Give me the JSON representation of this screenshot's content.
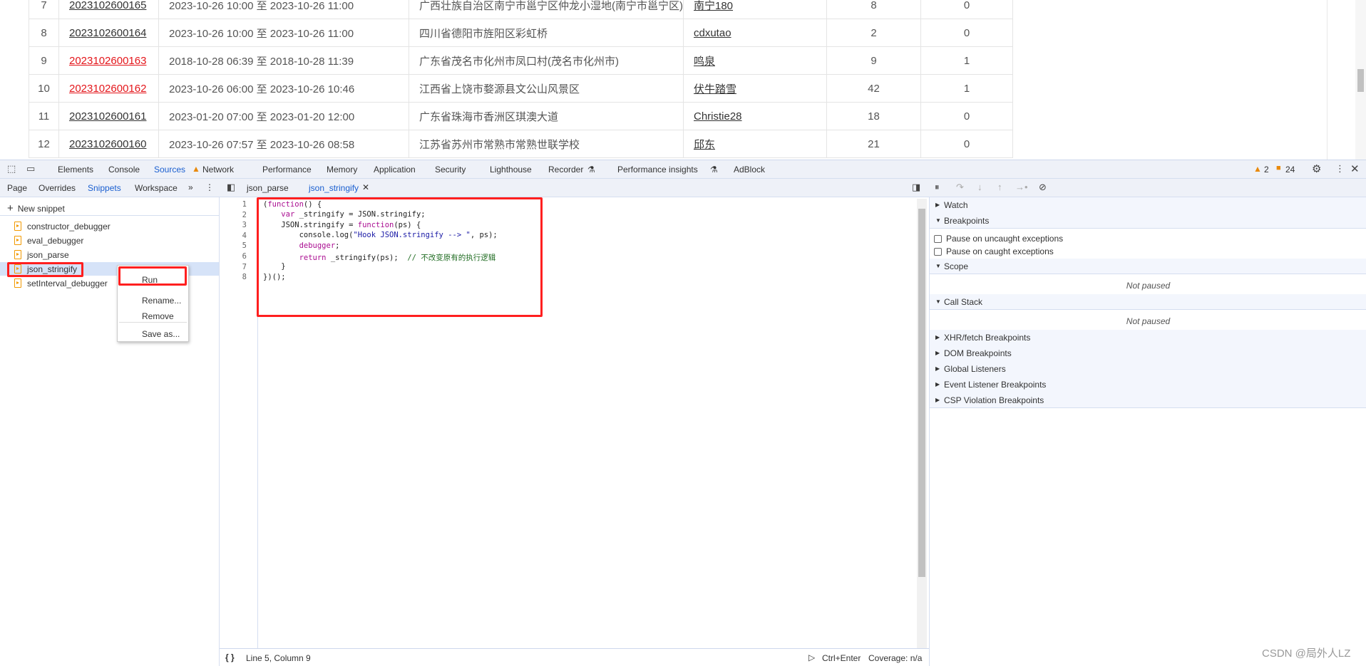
{
  "table": {
    "rows": [
      {
        "index": "7",
        "id": "2023102600165",
        "id_red": false,
        "time": "2023-10-26 10:00 至 2023-10-26 11:00",
        "address": "广西壮族自治区南宁市邕宁区仲龙小湿地(南宁市邕宁区)",
        "user": "南宁180",
        "count": "8",
        "flag": "0"
      },
      {
        "index": "8",
        "id": "2023102600164",
        "id_red": false,
        "time": "2023-10-26 10:00 至 2023-10-26 11:00",
        "address": "四川省德阳市旌阳区彩虹桥",
        "user": "cdxutao",
        "count": "2",
        "flag": "0"
      },
      {
        "index": "9",
        "id": "2023102600163",
        "id_red": true,
        "time": "2018-10-28 06:39 至 2018-10-28 11:39",
        "address": "广东省茂名市化州市凤口村(茂名市化州市)",
        "user": "鸣泉",
        "count": "9",
        "flag": "1"
      },
      {
        "index": "10",
        "id": "2023102600162",
        "id_red": true,
        "time": "2023-10-26 06:00 至 2023-10-26 10:46",
        "address": "江西省上饶市婺源县文公山风景区",
        "user": "伏牛踏雪",
        "count": "42",
        "flag": "1"
      },
      {
        "index": "11",
        "id": "2023102600161",
        "id_red": false,
        "time": "2023-01-20 07:00 至 2023-01-20 12:00",
        "address": "广东省珠海市香洲区琪澳大道",
        "user": "Christie28",
        "count": "18",
        "flag": "0"
      },
      {
        "index": "12",
        "id": "2023102600160",
        "id_red": false,
        "time": "2023-10-26 07:57 至 2023-10-26 08:58",
        "address": "江苏省苏州市常熟市常熟世联学校",
        "user": "邱东",
        "count": "21",
        "flag": "0"
      }
    ]
  },
  "devtools": {
    "tabs": [
      "Elements",
      "Console",
      "Sources",
      "Network",
      "Performance",
      "Memory",
      "Application",
      "Security",
      "Lighthouse",
      "Recorder",
      "Performance insights",
      "AdBlock"
    ],
    "active_tab": "Sources",
    "warnings": "2",
    "issues": "24",
    "nav_tabs": [
      "Page",
      "Overrides",
      "Snippets",
      "Workspace"
    ],
    "active_nav": "Snippets",
    "new_snippet": "New snippet",
    "snippets": [
      "constructor_debugger",
      "eval_debugger",
      "json_parse",
      "json_stringify",
      "setInterval_debugger"
    ],
    "selected_snippet": "json_stringify",
    "context_menu": {
      "run": "Run",
      "rename": "Rename...",
      "remove": "Remove",
      "save_as": "Save as..."
    },
    "editor_tabs": [
      "json_parse",
      "json_stringify"
    ],
    "active_editor_tab": "json_stringify",
    "code_lines": [
      "1",
      "2",
      "3",
      "4",
      "5",
      "6",
      "7",
      "8"
    ],
    "status": {
      "position": "Line 5, Column 9",
      "run_shortcut": "Ctrl+Enter",
      "coverage": "Coverage: n/a"
    },
    "debugger": {
      "watch": "Watch",
      "breakpoints": "Breakpoints",
      "pause_uncaught": "Pause on uncaught exceptions",
      "pause_caught": "Pause on caught exceptions",
      "scope": "Scope",
      "not_paused": "Not paused",
      "call_stack": "Call Stack",
      "xhr": "XHR/fetch Breakpoints",
      "dom": "DOM Breakpoints",
      "global": "Global Listeners",
      "event": "Event Listener Breakpoints",
      "csp": "CSP Violation Breakpoints"
    }
  },
  "watermark": "CSDN @局外人LZ",
  "colors": {
    "accent": "#1a73e8",
    "highlight": "#ff1f1f",
    "link_red": "#e4161b"
  }
}
